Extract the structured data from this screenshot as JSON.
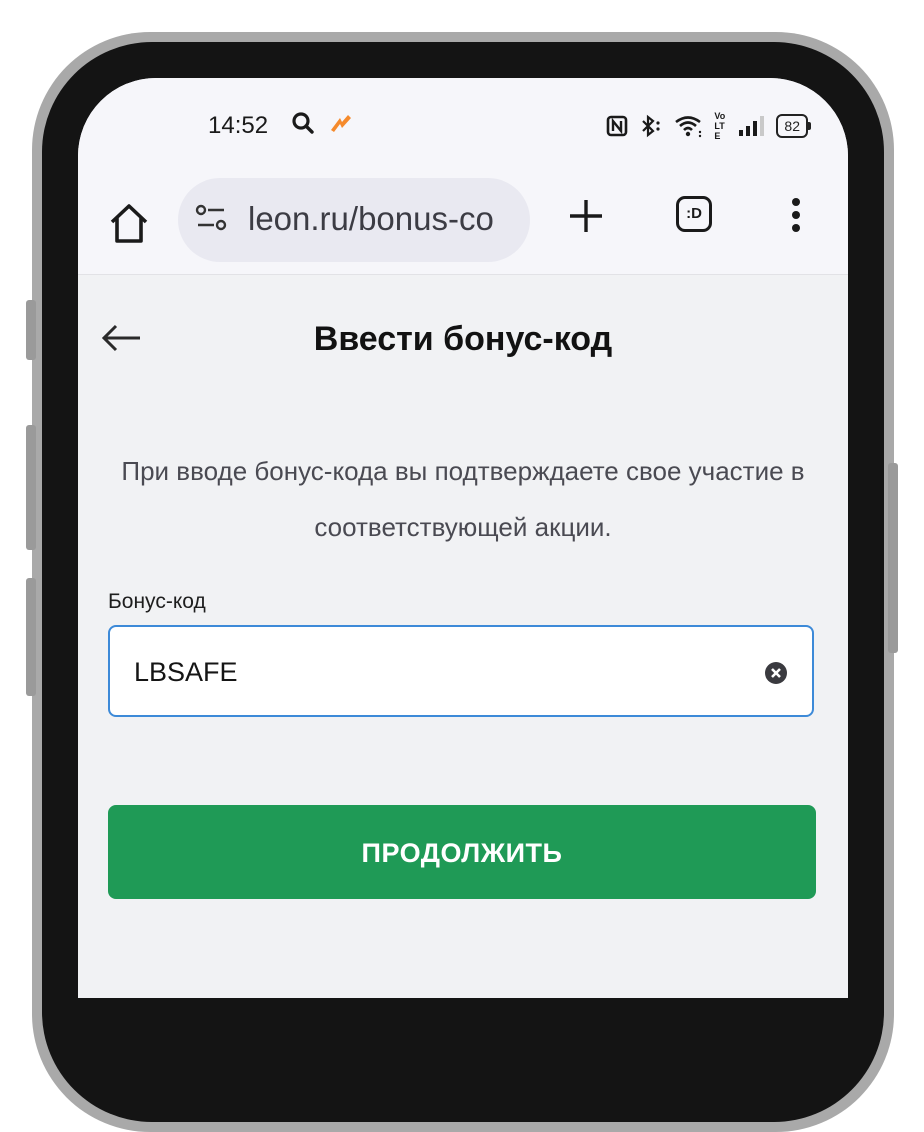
{
  "status_bar": {
    "time": "14:52",
    "battery": "82",
    "network_label": "Vo LTE"
  },
  "browser": {
    "url": "leon.ru/bonus-co",
    "tabs_label": ":D"
  },
  "page": {
    "title": "Ввести бонус-код",
    "description": "При вводе бонус-кода вы подтверждаете свое участие в соответствующей акции.",
    "field_label": "Бонус-код",
    "field_value": "LBSAFE",
    "continue_label": "ПРОДОЛЖИТЬ"
  },
  "icons": {
    "status": [
      "search-icon",
      "flame-icon",
      "nfc-icon",
      "bluetooth-icon",
      "wifi-icon",
      "volte-icon",
      "signal-icon",
      "battery-icon"
    ],
    "browser": [
      "home-icon",
      "site-settings-icon",
      "plus-icon",
      "tabs-icon",
      "more-vert-icon"
    ],
    "page": [
      "back-arrow-icon",
      "clear-icon"
    ]
  },
  "colors": {
    "accent_button": "#1f9a56",
    "input_focus_border": "#3d8ad8",
    "page_background": "#f1f2f4",
    "brand_flame": "#f58a2c"
  }
}
